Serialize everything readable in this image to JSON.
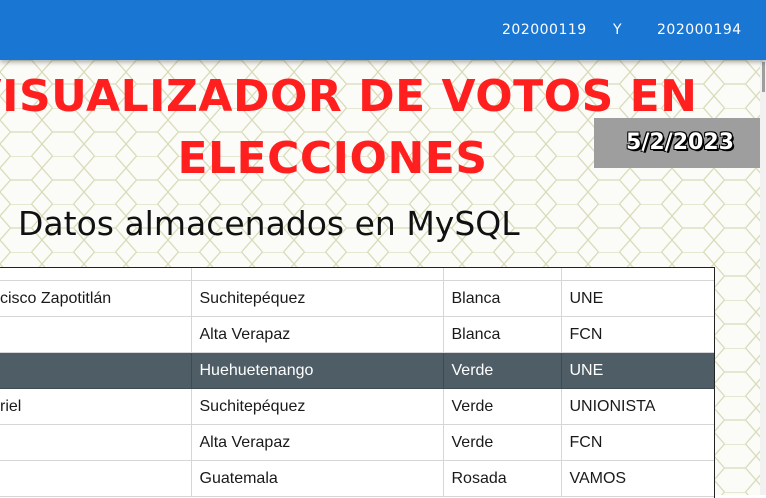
{
  "navbar": {
    "link1": "202000119",
    "link2": "Y",
    "link3": "202000194"
  },
  "title": {
    "line1": "VISUALIZADOR DE VOTOS EN",
    "line2": "ELECCIONES"
  },
  "date": "5/2/2023",
  "subtitle": "Datos almacenados en MySQL",
  "table": {
    "rows": [
      {
        "c0": "cisco Zapotitlán",
        "c1": "Suchitepéquez",
        "c2": "Blanca",
        "c3": "UNE",
        "selected": false
      },
      {
        "c0": "",
        "c1": "Alta Verapaz",
        "c2": "Blanca",
        "c3": "FCN",
        "selected": false
      },
      {
        "c0": "",
        "c1": "Huehuetenango",
        "c2": "Verde",
        "c3": "UNE",
        "selected": true
      },
      {
        "c0": "riel",
        "c1": "Suchitepéquez",
        "c2": "Verde",
        "c3": "UNIONISTA",
        "selected": false
      },
      {
        "c0": "",
        "c1": "Alta Verapaz",
        "c2": "Verde",
        "c3": "FCN",
        "selected": false
      },
      {
        "c0": "",
        "c1": "Guatemala",
        "c2": "Rosada",
        "c3": "VAMOS",
        "selected": false
      }
    ]
  },
  "colors": {
    "navbar": "#1976d2",
    "title": "#ff1f1f",
    "selected_row": "#4e5d66"
  }
}
